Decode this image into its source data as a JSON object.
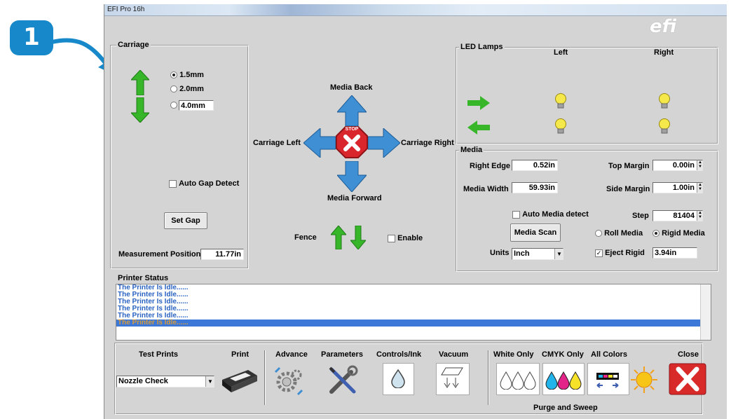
{
  "callout": {
    "number": "1",
    "color": "#1788c9"
  },
  "window": {
    "title": "EFI Pro 16h",
    "logo_text": "efi"
  },
  "carriage": {
    "legend": "Carriage",
    "options": [
      "1.5mm",
      "2.0mm",
      "4.0mm"
    ],
    "selected": "1.5mm",
    "auto_gap_label": "Auto Gap Detect",
    "set_gap_label": "Set Gap",
    "measurement_label": "Measurement Position",
    "measurement_value": "11.77in"
  },
  "movement": {
    "media_back": "Media Back",
    "media_forward": "Media Forward",
    "carriage_left": "Carriage Left",
    "carriage_right": "Carriage Right",
    "stop_text": "STOP"
  },
  "fence": {
    "label": "Fence",
    "enable_label": "Enable"
  },
  "led": {
    "legend": "LED Lamps",
    "col_left": "Left",
    "col_right": "Right"
  },
  "media": {
    "legend": "Media",
    "right_edge_label": "Right Edge",
    "right_edge_value": "0.52in",
    "top_margin_label": "Top Margin",
    "top_margin_value": "0.00in",
    "media_width_label": "Media Width",
    "media_width_value": "59.93in",
    "side_margin_label": "Side Margin",
    "side_margin_value": "1.00in",
    "auto_media_label": "Auto Media detect",
    "step_label": "Step",
    "step_value": "81404",
    "media_scan_label": "Media Scan",
    "roll_label": "Roll Media",
    "rigid_label": "Rigid Media",
    "units_label": "Units",
    "units_value": "Inch",
    "eject_label": "Eject Rigid",
    "eject_value": "3.94in"
  },
  "printer_status": {
    "legend": "Printer Status",
    "lines": [
      "The Printer Is Idle......",
      "The Printer Is Idle......",
      "The Printer Is Idle......",
      "The Printer Is Idle......",
      "The Printer Is Idle......",
      "The Printer Is Idle......"
    ]
  },
  "toolbar": {
    "test_prints": "Test Prints",
    "print": "Print",
    "test_select": "Nozzle Check",
    "advance": "Advance",
    "parameters": "Parameters",
    "controls_ink": "Controls/Ink",
    "vacuum": "Vacuum",
    "white_only": "White Only",
    "cmyk_only": "CMYK Only",
    "all_colors": "All Colors",
    "close": "Close",
    "purge_sweep": "Purge and Sweep"
  }
}
